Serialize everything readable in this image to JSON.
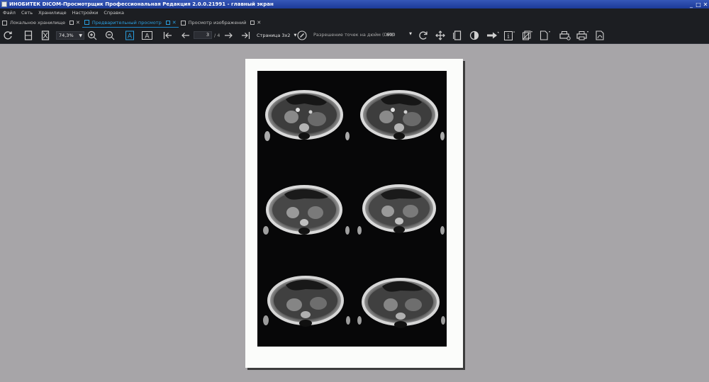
{
  "window": {
    "title": "ИНОБИТЕК DICOM-Просмотрщик Профессиональная Редакция 2.0.0.21991 - главный экран",
    "controls": [
      "_",
      "□",
      "✕"
    ]
  },
  "menu": [
    "Файл",
    "Сеть",
    "Хранилище",
    "Настройки",
    "Справка"
  ],
  "tabs": [
    {
      "label": "Локальное хранилище",
      "active": false
    },
    {
      "label": "Предварительный просмотр",
      "active": true
    },
    {
      "label": "Просмотр изображений",
      "active": false
    }
  ],
  "toolbar": {
    "zoom_value": "74,3%",
    "page_current": "3",
    "page_total": "/ 4",
    "page_layout": "Страница 3x2",
    "dpi_label": "Разрешение точек на дюйм (DPI)",
    "dpi_value": "600"
  },
  "colors": {
    "accent": "#1e87c8",
    "toolbar_bg": "#1c1e22",
    "titlebar": "#2a4aa8",
    "canvas": "#a7a5a8",
    "film": "#070708"
  }
}
